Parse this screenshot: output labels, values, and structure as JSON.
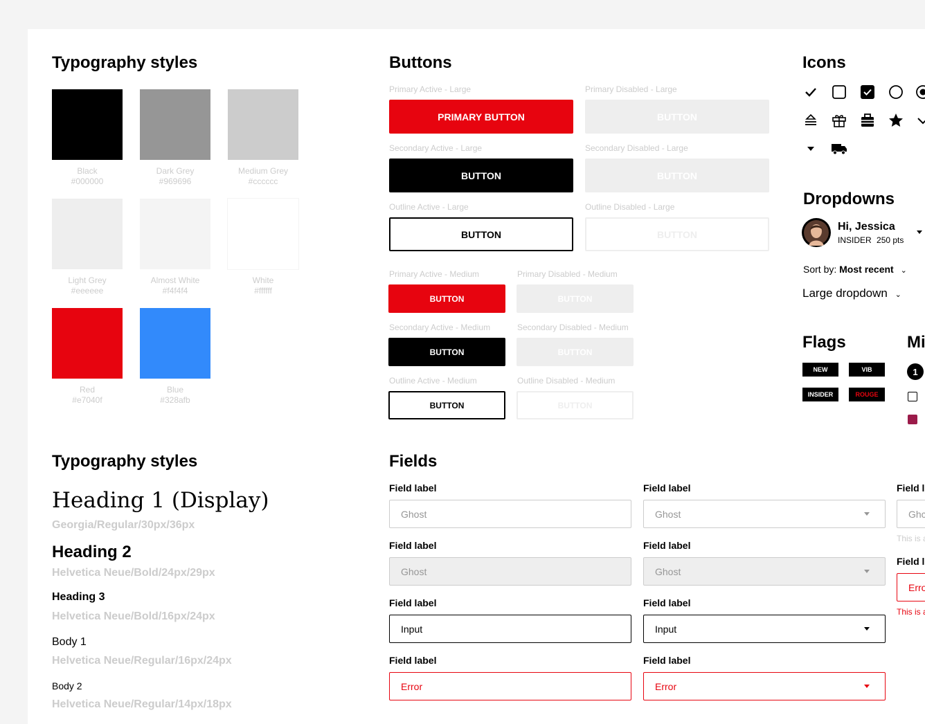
{
  "colors_section": {
    "title": "Typography styles",
    "swatches": [
      {
        "name": "Black",
        "hex": "#000000"
      },
      {
        "name": "Dark Grey",
        "hex": "#969696"
      },
      {
        "name": "Medium Grey",
        "hex": "#cccccc"
      },
      {
        "name": "Light Grey",
        "hex": "#eeeeee"
      },
      {
        "name": "Almost White",
        "hex": "#f4f4f4"
      },
      {
        "name": "White",
        "hex": "#ffffff"
      },
      {
        "name": "Red",
        "hex": "#e7040f"
      },
      {
        "name": "Blue",
        "hex": "#328afb"
      }
    ]
  },
  "buttons_section": {
    "title": "Buttons",
    "large": [
      {
        "caption": "Primary Active - Large",
        "label": "PRIMARY BUTTON"
      },
      {
        "caption": "Primary Disabled - Large",
        "label": "BUTTON"
      },
      {
        "caption": "Secondary Active - Large",
        "label": "BUTTON"
      },
      {
        "caption": "Secondary Disabled - Large",
        "label": "BUTTON"
      },
      {
        "caption": "Outline Active - Large",
        "label": "BUTTON"
      },
      {
        "caption": "Outline Disabled - Large",
        "label": "BUTTON"
      }
    ],
    "medium": [
      {
        "caption": "Primary Active - Medium",
        "label": "BUTTON"
      },
      {
        "caption": "Primary Disabled - Medium",
        "label": "BUTTON"
      },
      {
        "caption": "Secondary Active - Medium",
        "label": "BUTTON"
      },
      {
        "caption": "Secondary Disabled - Medium",
        "label": "BUTTON"
      },
      {
        "caption": "Outline Active - Medium",
        "label": "BUTTON"
      },
      {
        "caption": "Outline Disabled - Medium",
        "label": "BUTTON"
      }
    ]
  },
  "icons_section": {
    "title": "Icons",
    "icons": [
      "checkmark-icon",
      "checkbox-empty-icon",
      "checkbox-checked-icon",
      "radio-empty-icon",
      "radio-selected-icon",
      "filter-icon",
      "gift-icon",
      "briefcase-icon",
      "star-icon",
      "chevron-down-icon",
      "caret-down-icon",
      "truck-icon"
    ]
  },
  "dropdowns_section": {
    "title": "Dropdowns",
    "user": {
      "greeting": "Hi, Jessica",
      "tier": "INSIDER",
      "points": "250 pts"
    },
    "sort": {
      "prefix": "Sort by:",
      "value": "Most recent"
    },
    "large_dropdown": "Large dropdown"
  },
  "flags_section": {
    "title": "Flags",
    "flags": [
      "NEW",
      "VIB",
      "INSIDER",
      "ROUGE"
    ]
  },
  "misc_section": {
    "title": "Mi",
    "badge_number": "1"
  },
  "typography_section": {
    "title": "Typography styles",
    "styles": [
      {
        "sample": "Heading 1 (Display)",
        "spec": "Georgia/Regular/30px/36px"
      },
      {
        "sample": "Heading 2",
        "spec": "Helvetica Neue/Bold/24px/29px"
      },
      {
        "sample": "Heading 3",
        "spec": "Helvetica Neue/Bold/16px/24px"
      },
      {
        "sample": "Body 1",
        "spec": "Helvetica Neue/Regular/16px/24px"
      },
      {
        "sample": "Body 2",
        "spec": "Helvetica Neue/Regular/14px/18px"
      }
    ]
  },
  "fields_section": {
    "title": "Fields",
    "label": "Field label",
    "col1": [
      {
        "state": "ghost",
        "value": "Ghost"
      },
      {
        "state": "disabled",
        "value": "Ghost"
      },
      {
        "state": "input",
        "value": "Input"
      },
      {
        "state": "error",
        "value": "Error"
      }
    ],
    "col2": [
      {
        "state": "ghost",
        "value": "Ghost"
      },
      {
        "state": "disabled",
        "value": "Ghost"
      },
      {
        "state": "input",
        "value": "Input"
      },
      {
        "state": "error",
        "value": "Error"
      }
    ],
    "col3": {
      "label1": "Field l",
      "value1": "Ghc",
      "helper1": "This is a",
      "label2": "Field l",
      "value2": "Erro",
      "helper2": "This is a"
    }
  }
}
